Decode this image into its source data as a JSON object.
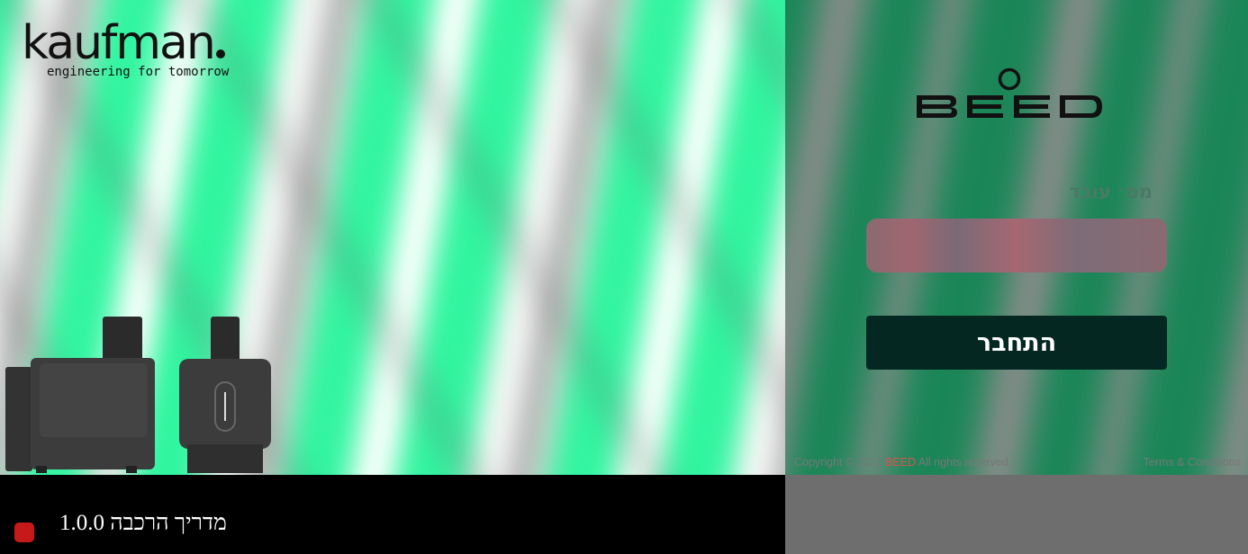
{
  "brand": {
    "logo_word": "kaufman",
    "logo_tagline": "engineering for tomorrow"
  },
  "login": {
    "logo_alt": "BEED",
    "employee_id_label": "מס׳ עובד",
    "employee_id_value": "",
    "login_button": "התחבר"
  },
  "footer": {
    "copyright_prefix": "Copyright © 2022 ",
    "copyright_brand": "BEED",
    "copyright_suffix": " All rights reserved.",
    "terms_link": "Terms & Conditions"
  },
  "bottom_bar": {
    "guide_title": "מדריך הרכבה 1.0.0"
  },
  "colors": {
    "accent_green": "#31f5a0",
    "button_bg": "#042722",
    "brand_red": "#d9534f",
    "badge_red": "#c61a1a"
  }
}
